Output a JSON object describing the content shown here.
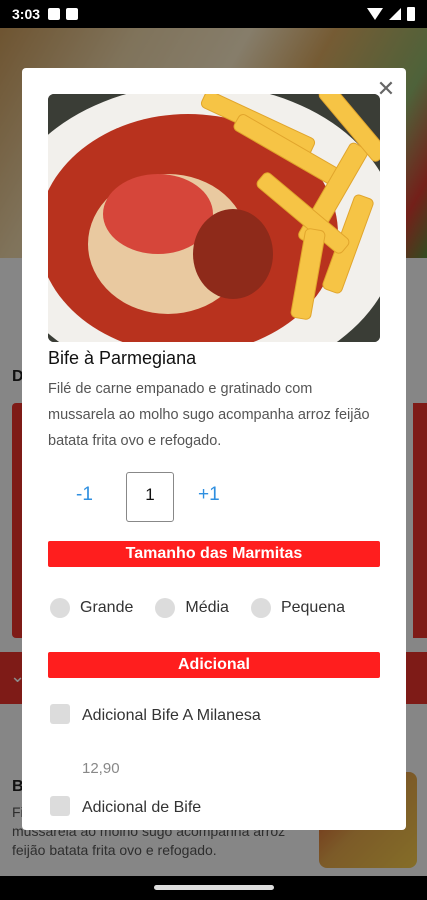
{
  "status_bar": {
    "time": "3:03",
    "icons": [
      "shield-icon",
      "sd-card-icon",
      "wifi-icon",
      "signal-icon",
      "battery-icon"
    ]
  },
  "background": {
    "section_letter": "D",
    "item_title": "B",
    "item_desc": "Filé de carne empanado e gratinado com mussarela ao molho sugo acompanha arroz feijão batata frita ovo e refogado."
  },
  "modal": {
    "close_icon": "close-icon",
    "product": {
      "name": "Bife à Parmegiana",
      "description": "Filé de carne empanado e gratinado com mussarela ao molho sugo acompanha arroz feijão batata frita ovo e refogado."
    },
    "quantity": {
      "minus_label": "-1",
      "value": "1",
      "plus_label": "+1"
    },
    "size_section": {
      "title": "Tamanho das Marmitas",
      "options": [
        "Grande",
        "Média",
        "Pequena"
      ]
    },
    "addon_section": {
      "title": "Adicional",
      "items": [
        {
          "name": "Adicional Bife A Milanesa",
          "price": "12,90"
        },
        {
          "name": "Adicional de Bife",
          "price": ""
        }
      ]
    }
  },
  "colors": {
    "accent_red": "#ff1e1e",
    "link_blue": "#2f8fe0"
  }
}
